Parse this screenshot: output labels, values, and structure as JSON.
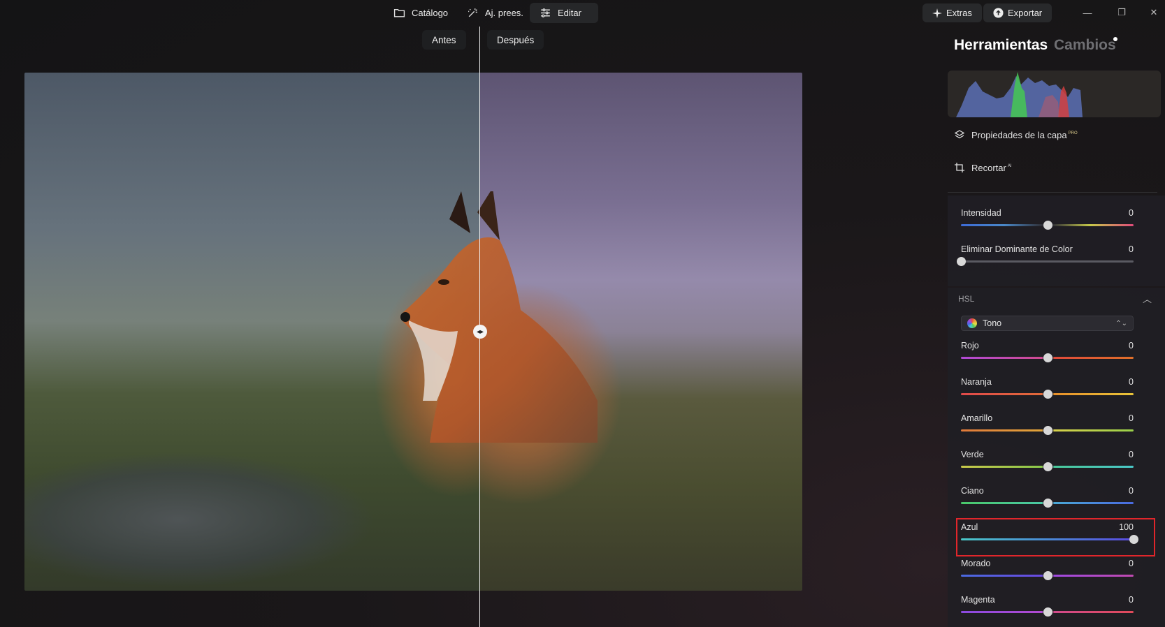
{
  "topbar": {
    "nav": [
      {
        "label": "Catálogo",
        "icon": "folder-icon"
      },
      {
        "label": "Aj. prees.",
        "icon": "magic-wand-icon"
      },
      {
        "label": "Editar",
        "icon": "sliders-icon",
        "active": true
      }
    ],
    "extras_label": "Extras",
    "export_label": "Exportar"
  },
  "compare": {
    "before_label": "Antes",
    "after_label": "Después"
  },
  "panel": {
    "tab_tools": "Herramientas",
    "tab_changes": "Cambios",
    "layer_properties": "Propiedades de la capa",
    "layer_badge": "PRO",
    "crop": "Recortar",
    "crop_badge": "AI",
    "top_sliders": [
      {
        "label": "Intensidad",
        "value": "0",
        "position": 0.5
      },
      {
        "label": "Eliminar Dominante de Color",
        "value": "0",
        "position": 0.0
      }
    ],
    "hsl_header": "HSL",
    "hsl_select": "Tono",
    "hsl_sliders": [
      {
        "label": "Rojo",
        "value": "0",
        "position": 0.5
      },
      {
        "label": "Naranja",
        "value": "0",
        "position": 0.5
      },
      {
        "label": "Amarillo",
        "value": "0",
        "position": 0.5
      },
      {
        "label": "Verde",
        "value": "0",
        "position": 0.5
      },
      {
        "label": "Ciano",
        "value": "0",
        "position": 0.5
      },
      {
        "label": "Azul",
        "value": "100",
        "position": 1.0,
        "highlighted": true
      },
      {
        "label": "Morado",
        "value": "0",
        "position": 0.5
      },
      {
        "label": "Magenta",
        "value": "0",
        "position": 0.5
      }
    ]
  },
  "colors": {
    "accent_highlight": "#e0262b",
    "panel_bg": "#201e24"
  }
}
